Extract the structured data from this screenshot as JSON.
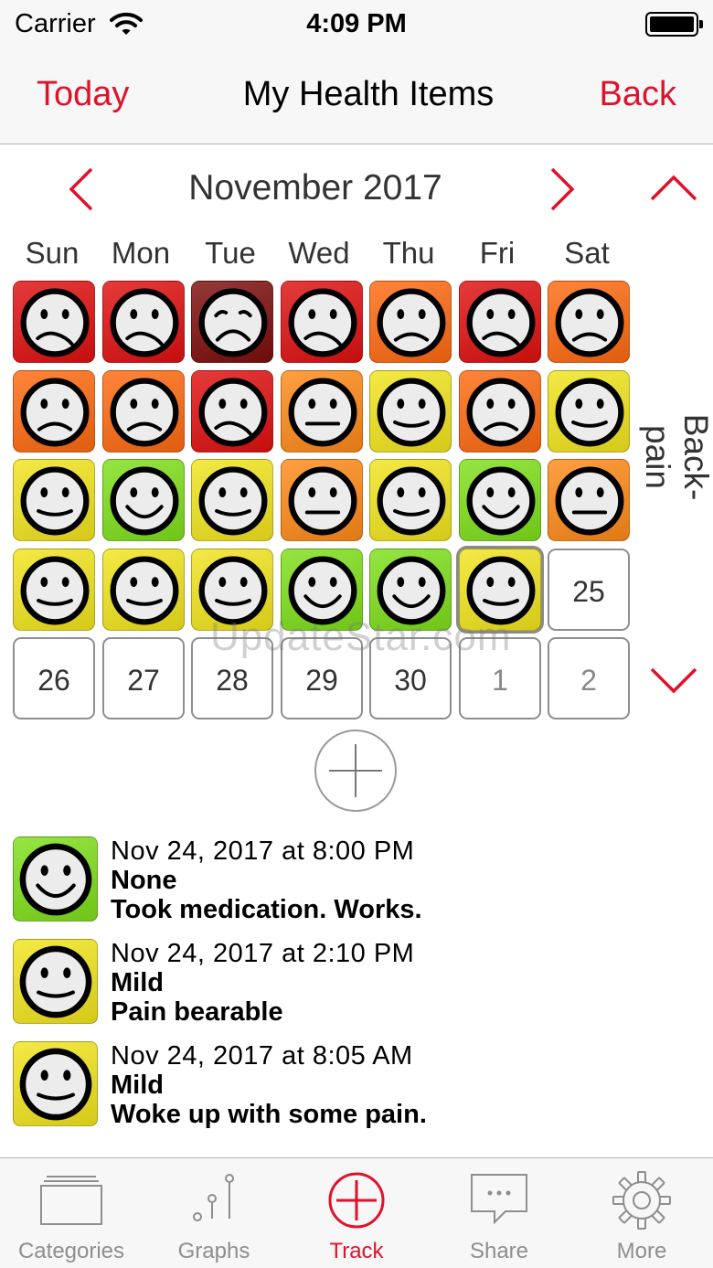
{
  "status_bar": {
    "carrier": "Carrier",
    "time": "4:09 PM"
  },
  "nav": {
    "left": "Today",
    "title": "My Health Items",
    "right": "Back"
  },
  "calendar": {
    "month": "November 2017",
    "weekdays": [
      "Sun",
      "Mon",
      "Tue",
      "Wed",
      "Thu",
      "Fri",
      "Sat"
    ],
    "item_label": "Back-pain",
    "weeks": [
      [
        {
          "kind": "face",
          "color": "#e01010",
          "mood": "sad-wavy"
        },
        {
          "kind": "face",
          "color": "#e01010",
          "mood": "sad-wavy"
        },
        {
          "kind": "face",
          "color": "#7e0d0d",
          "mood": "cry"
        },
        {
          "kind": "face",
          "color": "#e01010",
          "mood": "sad-wavy"
        },
        {
          "kind": "face",
          "color": "#ff6a10",
          "mood": "frown"
        },
        {
          "kind": "face",
          "color": "#e01010",
          "mood": "sad-wavy"
        },
        {
          "kind": "face",
          "color": "#ff6a10",
          "mood": "frown"
        }
      ],
      [
        {
          "kind": "face",
          "color": "#ff6a10",
          "mood": "frown"
        },
        {
          "kind": "face",
          "color": "#ff6a10",
          "mood": "frown"
        },
        {
          "kind": "face",
          "color": "#e01010",
          "mood": "sad-wavy"
        },
        {
          "kind": "face",
          "color": "#ff8a18",
          "mood": "neutral"
        },
        {
          "kind": "face",
          "color": "#f2e51d",
          "mood": "mild"
        },
        {
          "kind": "face",
          "color": "#ff6a10",
          "mood": "frown"
        },
        {
          "kind": "face",
          "color": "#f2e51d",
          "mood": "mild"
        }
      ],
      [
        {
          "kind": "face",
          "color": "#f2e51d",
          "mood": "mild"
        },
        {
          "kind": "face",
          "color": "#7fe01a",
          "mood": "happy"
        },
        {
          "kind": "face",
          "color": "#f2e51d",
          "mood": "mild"
        },
        {
          "kind": "face",
          "color": "#ff8a18",
          "mood": "neutral"
        },
        {
          "kind": "face",
          "color": "#f2e51d",
          "mood": "mild"
        },
        {
          "kind": "face",
          "color": "#7fe01a",
          "mood": "happy"
        },
        {
          "kind": "face",
          "color": "#ff8a18",
          "mood": "neutral"
        }
      ],
      [
        {
          "kind": "face",
          "color": "#f2e51d",
          "mood": "mild"
        },
        {
          "kind": "face",
          "color": "#f2e51d",
          "mood": "mild"
        },
        {
          "kind": "face",
          "color": "#f2e51d",
          "mood": "mild"
        },
        {
          "kind": "face",
          "color": "#7fe01a",
          "mood": "happy"
        },
        {
          "kind": "face",
          "color": "#7fe01a",
          "mood": "happy"
        },
        {
          "kind": "face",
          "color": "#f2e51d",
          "mood": "mild",
          "selected": true
        },
        {
          "kind": "day",
          "label": "25"
        }
      ],
      [
        {
          "kind": "day",
          "label": "26"
        },
        {
          "kind": "day",
          "label": "27"
        },
        {
          "kind": "day",
          "label": "28"
        },
        {
          "kind": "day",
          "label": "29"
        },
        {
          "kind": "day",
          "label": "30"
        },
        {
          "kind": "day",
          "label": "1",
          "muted": true
        },
        {
          "kind": "day",
          "label": "2",
          "muted": true
        }
      ]
    ]
  },
  "watermark": "UpdateStar.com",
  "entries": [
    {
      "date": "Nov 24, 2017 at 8:00 PM",
      "level": "None",
      "note": "Took medication. Works.",
      "color": "#7fe01a",
      "mood": "happy"
    },
    {
      "date": "Nov 24, 2017 at 2:10 PM",
      "level": "Mild",
      "note": "Pain bearable",
      "color": "#f2e51d",
      "mood": "mild"
    },
    {
      "date": "Nov 24, 2017 at 8:05 AM",
      "level": "Mild",
      "note": "Woke up with some pain.",
      "color": "#f2e51d",
      "mood": "mild"
    }
  ],
  "tabs": [
    {
      "label": "Categories",
      "icon": "categories-icon"
    },
    {
      "label": "Graphs",
      "icon": "graphs-icon"
    },
    {
      "label": "Track",
      "icon": "track-icon",
      "active": true
    },
    {
      "label": "Share",
      "icon": "share-icon"
    },
    {
      "label": "More",
      "icon": "gear-icon"
    }
  ],
  "accent": "#e0112b"
}
